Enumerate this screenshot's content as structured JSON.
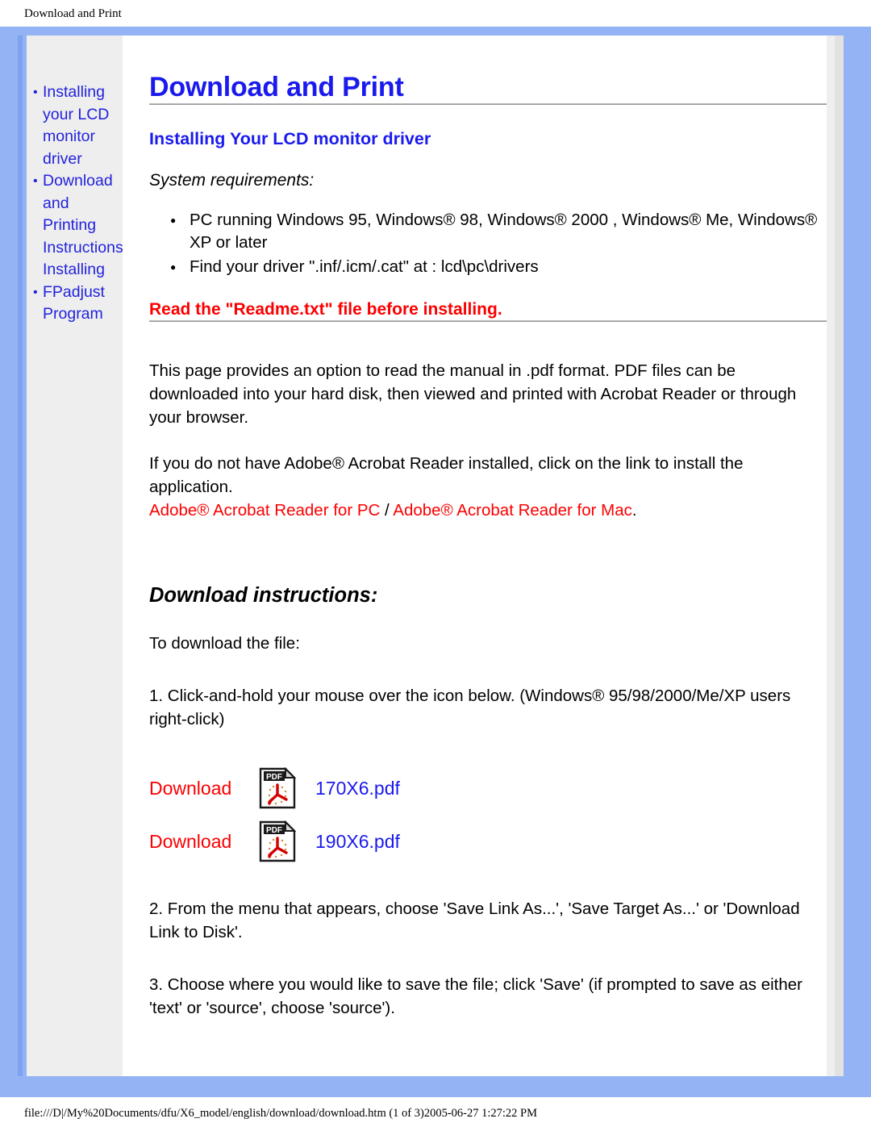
{
  "print_header": "Download and Print",
  "print_footer": "file:///D|/My%20Documents/dfu/X6_model/english/download/download.htm (1 of 3)2005-06-27 1:27:22 PM",
  "colors": {
    "frame_blue": "#94b3f4",
    "frame_stripe": "#7da2f0",
    "link_blue": "#1a1aee",
    "link_red": "#fb0000",
    "sidebar_bg": "#eeeeee"
  },
  "sidebar": {
    "items": [
      {
        "label": "Installing your LCD monitor driver",
        "bullet": true
      },
      {
        "label": "Download and Printing Instructions",
        "bullet": true
      },
      {
        "label": "Installing",
        "bullet": false
      },
      {
        "label": "FPadjust Program",
        "bullet": true
      }
    ]
  },
  "main": {
    "title": "Download and Print",
    "section_title": "Installing Your LCD monitor driver",
    "system_requirements_label": "System requirements:",
    "requirements": [
      "PC running Windows 95, Windows® 98, Windows® 2000 , Windows® Me, Windows® XP or later",
      "Find your driver \".inf/.icm/.cat\" at : lcd\\pc\\drivers"
    ],
    "readme_warning": "Read the \"Readme.txt\" file before installing.",
    "paragraph_1": "This page provides an option to read the manual in .pdf format. PDF files can be downloaded into your hard disk, then viewed and printed with Acrobat Reader or through your browser.",
    "paragraph_2": "If you do not have Adobe® Acrobat Reader installed, click on the link to install the application.",
    "acrobat_link_pc": "Adobe® Acrobat Reader for PC",
    "acrobat_link_separator": " / ",
    "acrobat_link_mac": "Adobe® Acrobat Reader for Mac",
    "acrobat_link_period": ".",
    "download_instructions_title": "Download instructions:",
    "to_download_label": "To download the file:",
    "step_1": "1. Click-and-hold your mouse over the icon below. (Windows® 95/98/2000/Me/XP users right-click)",
    "step_2": "2. From the menu that appears, choose 'Save Link As...', 'Save Target As...' or 'Download Link to Disk'.",
    "step_3": "3. Choose where you would like to save the file; click 'Save' (if prompted to save as either 'text' or 'source', choose 'source').",
    "downloads": [
      {
        "action": "Download",
        "icon": "pdf-icon",
        "filename": "170X6.pdf"
      },
      {
        "action": "Download",
        "icon": "pdf-icon",
        "filename": "190X6.pdf"
      }
    ]
  }
}
